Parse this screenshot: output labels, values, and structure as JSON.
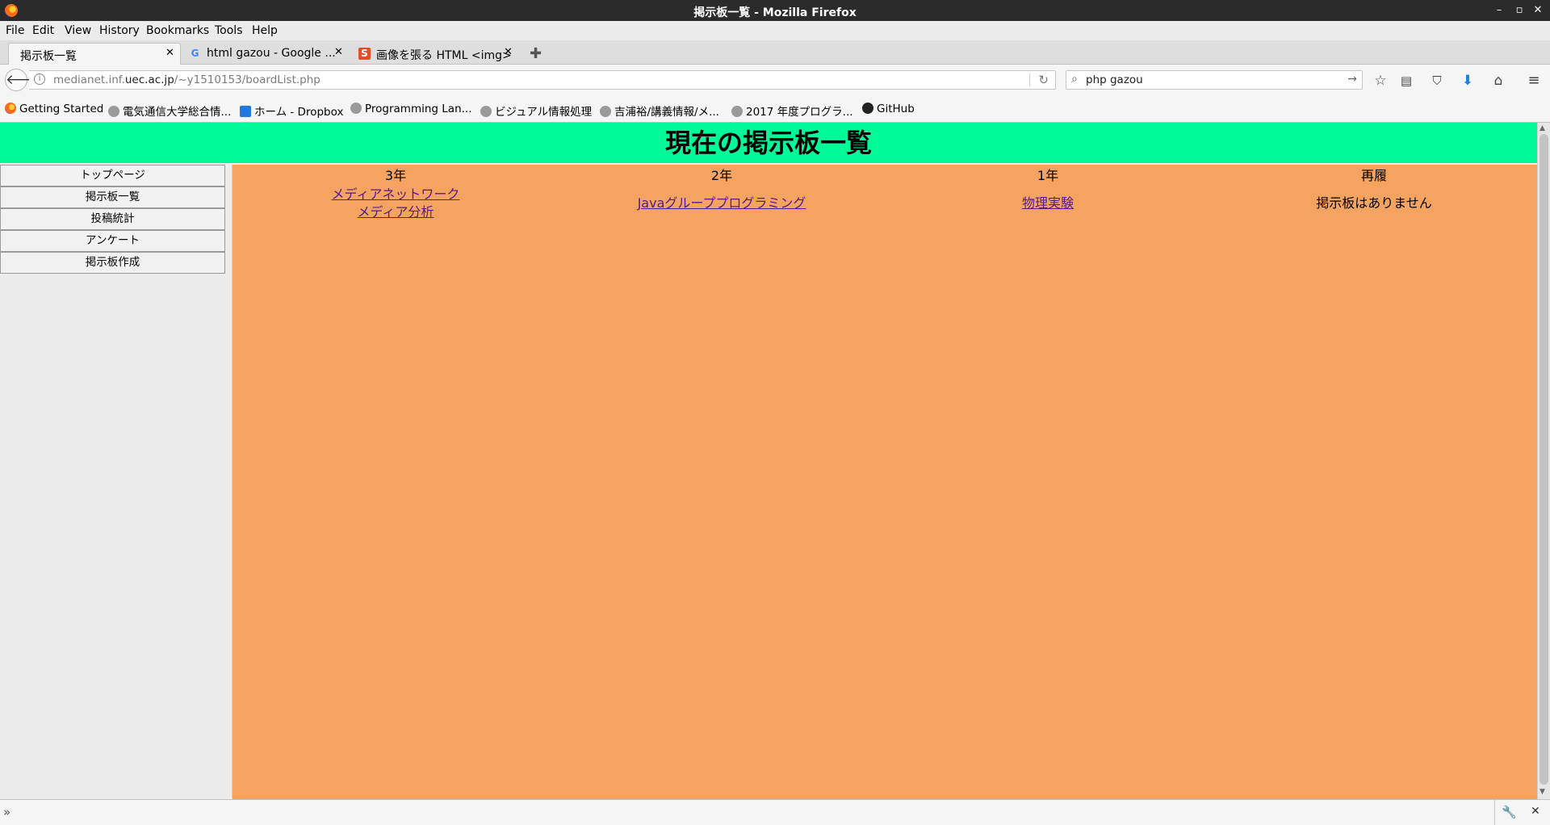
{
  "window": {
    "title": "掲示板一覧 - Mozilla Firefox",
    "controls": [
      "–",
      "▫",
      "✕"
    ]
  },
  "menu": [
    "File",
    "Edit",
    "View",
    "History",
    "Bookmarks",
    "Tools",
    "Help"
  ],
  "tabs": [
    {
      "label": "掲示板一覧",
      "icon": "none"
    },
    {
      "label": "html gazou - Google ...",
      "icon": "google-icon"
    },
    {
      "label": "画像を張る HTML <img>",
      "icon": "s-icon"
    }
  ],
  "nav": {
    "url_prefix": "medianet.inf.",
    "url_domain": "uec.ac.jp",
    "url_path": "/~y1510153/boardList.php",
    "search_value": "php gazou"
  },
  "bookmarks": [
    {
      "label": "Getting Started",
      "icon": "firefox-icon"
    },
    {
      "label": "電気通信大学総合情...",
      "icon": "globe-icon"
    },
    {
      "label": "ホーム - Dropbox",
      "icon": "dropbox-icon"
    },
    {
      "label": "Programming Lan...",
      "icon": "globe-icon"
    },
    {
      "label": "ビジュアル情報処理",
      "icon": "globe-icon"
    },
    {
      "label": "吉浦裕/講義情報/メ...",
      "icon": "globe-icon"
    },
    {
      "label": "2017 年度プログラ...",
      "icon": "globe-icon"
    },
    {
      "label": "GitHub",
      "icon": "github-icon"
    }
  ],
  "page": {
    "heading": "現在の掲示板一覧",
    "header_color": "#00fa9a",
    "content_color": "#f4a460",
    "sidebar": [
      "トップページ",
      "掲示板一覧",
      "投稿統計",
      "アンケート",
      "掲示板作成"
    ],
    "columns": [
      {
        "heading": "3年",
        "links": [
          "メディアネットワーク",
          "メディア分析"
        ],
        "empty": ""
      },
      {
        "heading": "2年",
        "links": [
          "Javaグループプログラミング"
        ],
        "empty": ""
      },
      {
        "heading": "1年",
        "links": [
          "物理実験"
        ],
        "empty": ""
      },
      {
        "heading": "再履",
        "links": [],
        "empty": "掲示板はありません"
      }
    ]
  }
}
